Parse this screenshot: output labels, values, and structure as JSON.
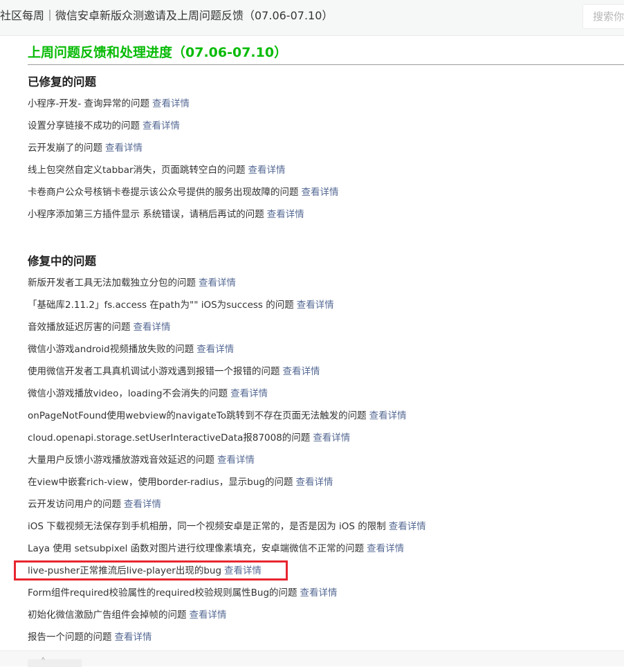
{
  "header": {
    "title": "社区每周｜微信安卓新版众测邀请及上周问题反馈（07.06-07.10）",
    "search_placeholder": "搜索你"
  },
  "main": {
    "heading": "上周问题反馈和处理进度（07.06-07.10）",
    "link_label": "查看详情",
    "fixed": {
      "title": "已修复的问题",
      "items": [
        "小程序-开发- 查询异常的问题",
        "设置分享链接不成功的问题",
        "云开发崩了的问题",
        "线上包突然自定义tabbar消失，页面跳转空白的问题",
        "卡卷商户公众号核销卡卷提示该公众号提供的服务出现故障的问题",
        "小程序添加第三方插件显示 系统错误，请稍后再试的问题"
      ]
    },
    "fixing": {
      "title": "修复中的问题",
      "items": [
        "新版开发者工具无法加载独立分包的问题",
        "「基础库2.11.2」fs.access 在path为\"\" iOS为success 的问题",
        "音效播放延迟厉害的问题",
        "微信小游戏android视频播放失败的问题",
        "使用微信开发者工具真机调试小游戏遇到报错一个报错的问题",
        "微信小游戏播放video，loading不会消失的问题",
        "onPageNotFound使用webview的navigateTo跳转到不存在页面无法触发的问题",
        "cloud.openapi.storage.setUserInteractiveData报87008的问题",
        "大量用户反馈小游戏播放游戏音效延迟的问题",
        "在view中嵌套rich-view，使用border-radius，显示bug的问题",
        "云开发访问用户的问题",
        "iOS 下载视频无法保存到手机相册，同一个视频安卓是正常的，是否是因为 iOS 的限制",
        "Laya 使用 setsubpixel 函数对图片进行纹理像素填充，安卓端微信不正常的问题",
        "live-pusher正常推流后live-player出现的bug",
        "Form组件required校验属性的required校验规则属性Bug的问题",
        "初始化微信激励广告组件会掉帧的问题",
        "报告一个问题的问题"
      ]
    }
  },
  "colors": {
    "heading": "#09bb07",
    "link": "#576b95",
    "highlight_box": "#e8262f"
  }
}
